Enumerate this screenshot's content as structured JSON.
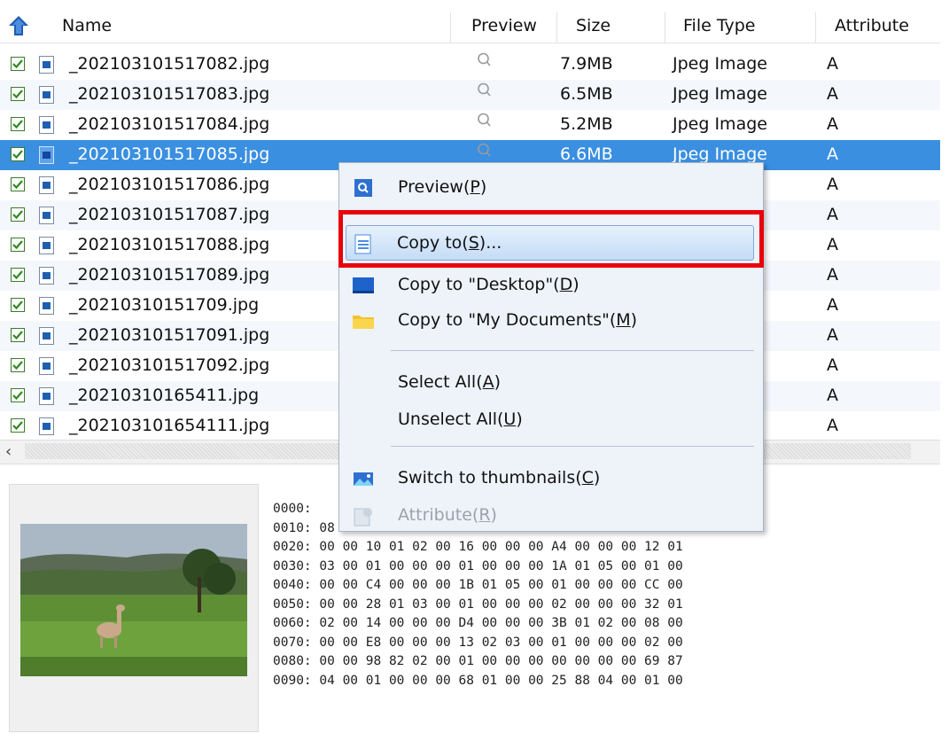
{
  "columns": {
    "name": "Name",
    "preview": "Preview",
    "size": "Size",
    "file_type": "File Type",
    "attribute": "Attribute"
  },
  "files": [
    {
      "name": "_202103101517082.jpg",
      "size": "7.9MB",
      "type": "Jpeg Image",
      "attr": "A",
      "checked": true
    },
    {
      "name": "_202103101517083.jpg",
      "size": "6.5MB",
      "type": "Jpeg Image",
      "attr": "A",
      "checked": true
    },
    {
      "name": "_202103101517084.jpg",
      "size": "5.2MB",
      "type": "Jpeg Image",
      "attr": "A",
      "checked": true
    },
    {
      "name": "_202103101517085.jpg",
      "size": "6.6MB",
      "type": "Jpeg Image",
      "attr": "A",
      "checked": true,
      "selected": true
    },
    {
      "name": "_202103101517086.jpg",
      "size": "",
      "type": "ge",
      "attr": "A",
      "checked": true
    },
    {
      "name": "_202103101517087.jpg",
      "size": "",
      "type": "ge",
      "attr": "A",
      "checked": true
    },
    {
      "name": "_202103101517088.jpg",
      "size": "",
      "type": "ge",
      "attr": "A",
      "checked": true
    },
    {
      "name": "_202103101517089.jpg",
      "size": "",
      "type": "ge",
      "attr": "A",
      "checked": true
    },
    {
      "name": "_2021031015170​9.jpg",
      "size": "",
      "type": "ge",
      "attr": "A",
      "checked": true
    },
    {
      "name": "_202103101517091.jpg",
      "size": "",
      "type": "ge",
      "attr": "A",
      "checked": true
    },
    {
      "name": "_202103101517092.jpg",
      "size": "",
      "type": "ge",
      "attr": "A",
      "checked": true
    },
    {
      "name": "_20210310165411.jpg",
      "size": "",
      "type": "ge",
      "attr": "A",
      "checked": true
    },
    {
      "name": "_202103101654111.jpg",
      "size": "",
      "type": "ge",
      "attr": "A",
      "checked": true
    }
  ],
  "context_menu": {
    "preview": {
      "text": "Preview(",
      "key": "P",
      "tail": ")"
    },
    "copy_to": {
      "text": "Copy to(",
      "key": "S",
      "tail": ")..."
    },
    "copy_desktop": {
      "text": "Copy to \"Desktop\"(",
      "key": "D",
      "tail": ")"
    },
    "copy_docs": {
      "text": "Copy to \"My Documents\"(",
      "key": "M",
      "tail": ")"
    },
    "select_all": {
      "text": "Select All(",
      "key": "A",
      "tail": ")"
    },
    "unselect_all": {
      "text": "Unselect All(",
      "key": "U",
      "tail": ")"
    },
    "thumbnails": {
      "text": "Switch to thumbnails(",
      "key": "C",
      "tail": ")"
    },
    "attribute": {
      "text": "Attribute(",
      "key": "R",
      "tail": ")"
    }
  },
  "hex_lines": [
    "0000:                                          00 49 49 2A 00",
    "0010: 08 00 00 00 0C 00 0F 01 02 00 06 00 00 00 9E 00",
    "0020: 00 00 10 01 02 00 16 00 00 00 A4 00 00 00 12 01",
    "0030: 03 00 01 00 00 00 01 00 00 00 1A 01 05 00 01 00",
    "0040: 00 00 C4 00 00 00 1B 01 05 00 01 00 00 00 CC 00",
    "0050: 00 00 28 01 03 00 01 00 00 00 02 00 00 00 32 01",
    "0060: 02 00 14 00 00 00 D4 00 00 00 3B 01 02 00 08 00",
    "0070: 00 00 E8 00 00 00 13 02 03 00 01 00 00 00 02 00",
    "0080: 00 00 98 82 02 00 01 00 00 00 00 00 00 00 69 87",
    "0090: 04 00 01 00 00 00 68 01 00 00 25 88 04 00 01 00"
  ],
  "colors": {
    "selection": "#3a8fe0",
    "highlight_box": "#e8000b",
    "menu_bg": "#eef3fa"
  },
  "icons": {
    "up": "up-arrow-icon",
    "preview": "magnifier-icon"
  }
}
